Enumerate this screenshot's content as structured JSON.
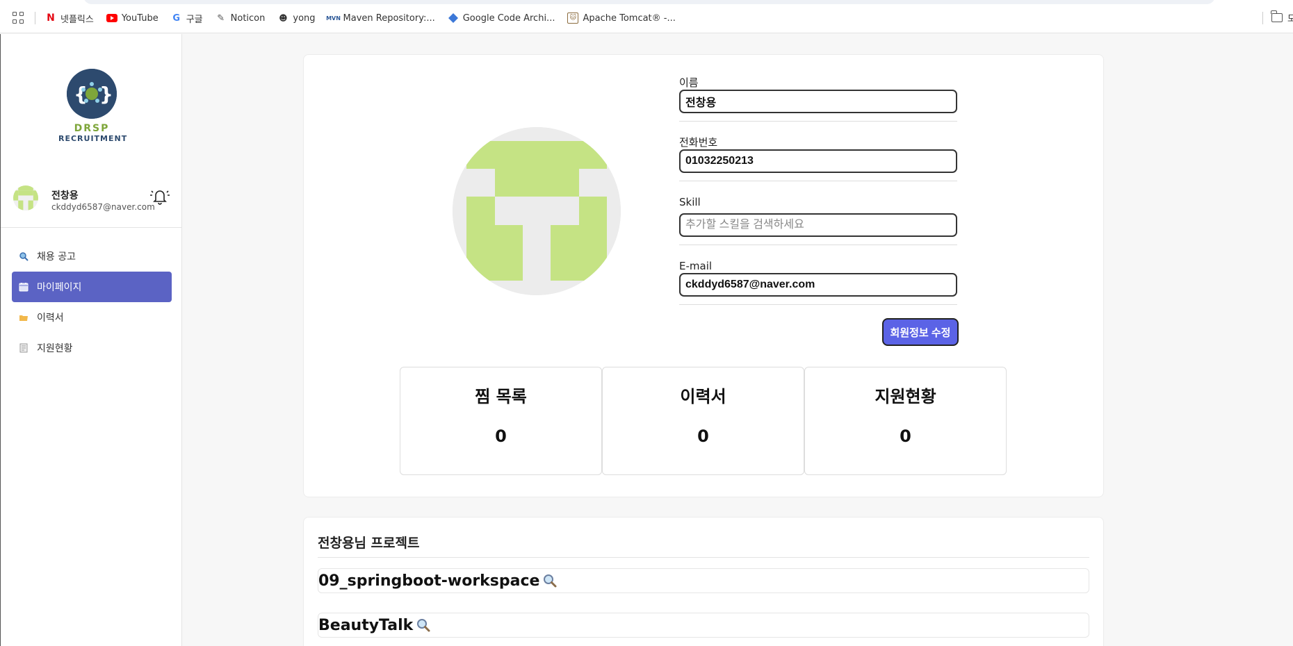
{
  "bookmarks": {
    "items": [
      {
        "label": "넷플릭스",
        "icon": "netflix-icon",
        "color": "#e50914"
      },
      {
        "label": "YouTube",
        "icon": "youtube-icon",
        "color": "#ff0000"
      },
      {
        "label": "구글",
        "icon": "google-icon",
        "color": "#4285f4"
      },
      {
        "label": "Noticon",
        "icon": "noticon-icon",
        "color": "#555555"
      },
      {
        "label": "yong",
        "icon": "yong-icon",
        "color": "#333333"
      },
      {
        "label": "Maven Repository:...",
        "icon": "maven-icon",
        "color": "#2b5797"
      },
      {
        "label": "Google Code Archi...",
        "icon": "google-code-icon",
        "color": "#3c78d8"
      },
      {
        "label": "Apache Tomcat® -...",
        "icon": "tomcat-icon",
        "color": "#8b6b3d"
      }
    ],
    "right_label": "모든"
  },
  "sidebar": {
    "logo": {
      "line1": "DRSP",
      "line2": "RECRUITMENT"
    },
    "user": {
      "name": "전창용",
      "email": "ckddyd6587@naver.com"
    },
    "menu": [
      {
        "label": "채용 공고",
        "icon": "magnifier-icon",
        "active": false
      },
      {
        "label": "마이페이지",
        "icon": "calendar-icon",
        "active": true
      },
      {
        "label": "이력서",
        "icon": "folder-icon",
        "active": false
      },
      {
        "label": "지원현황",
        "icon": "document-icon",
        "active": false
      }
    ]
  },
  "profile_form": {
    "name": {
      "label": "이름",
      "value": "전창용"
    },
    "phone": {
      "label": "전화번호",
      "value": "01032250213"
    },
    "skill": {
      "label": "Skill",
      "placeholder": "추가할 스킬을 검색하세요",
      "value": ""
    },
    "email": {
      "label": "E-mail",
      "value": "ckddyd6587@naver.com"
    },
    "edit_button": "회원정보 수정"
  },
  "stats": [
    {
      "title": "찜 목록",
      "value": "0"
    },
    {
      "title": "이력서",
      "value": "0"
    },
    {
      "title": "지원현황",
      "value": "0"
    }
  ],
  "projects": {
    "title": "전창용님 프로젝트",
    "items": [
      "09_springboot-workspace",
      "BeautyTalk"
    ]
  },
  "colors": {
    "accent": "#5b63c4",
    "button": "#5b63e6",
    "avatar_green": "#c5e384",
    "logo_navy": "#2d4a6e",
    "logo_green": "#7ea63a"
  }
}
